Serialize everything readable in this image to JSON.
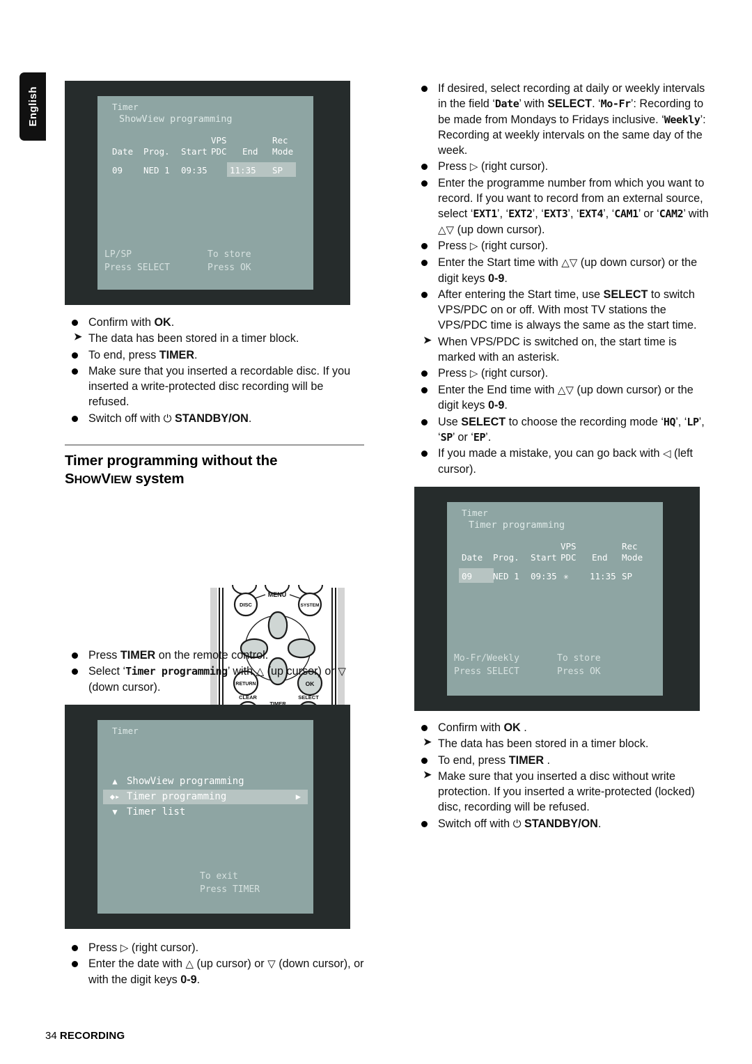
{
  "language_tab": {
    "label": "English"
  },
  "footer": {
    "page_number": "34",
    "section": "RECORDING"
  },
  "heading": {
    "line1": "Timer programming without the",
    "line2_cap": "S",
    "line2_small1": "HOW",
    "line2_cap2": "V",
    "line2_small2": "IEW",
    "line2_rest": " system"
  },
  "screen_showview": {
    "title": "Timer",
    "subtitle": "ShowView programming",
    "headers": {
      "date": "Date",
      "prog": "Prog.",
      "start": "Start",
      "vps": "VPS",
      "pdc": "PDC",
      "end": "End",
      "rec": "Rec",
      "mode": "Mode"
    },
    "row": {
      "date": "09",
      "prog": "NED 1",
      "start": "09:35",
      "vpspdc": "",
      "end": "11:35",
      "mode": "SP"
    },
    "footer_left_1": "LP/SP",
    "footer_left_2": "Press SELECT",
    "footer_right_1": "To store",
    "footer_right_2": "Press OK"
  },
  "screen_timer_menu": {
    "title": "Timer",
    "items": [
      {
        "marker": "▲",
        "label": "ShowView programming",
        "selected": false,
        "right": ""
      },
      {
        "marker": "◆▸",
        "label": "Timer programming",
        "selected": true,
        "right": "▶"
      },
      {
        "marker": "▼",
        "label": "Timer list",
        "selected": false,
        "right": ""
      }
    ],
    "footer_1": "To exit",
    "footer_2": "Press TIMER"
  },
  "screen_timer_programming": {
    "title": "Timer",
    "subtitle": "Timer programming",
    "headers": {
      "date": "Date",
      "prog": "Prog.",
      "start": "Start",
      "vps": "VPS",
      "pdc": "PDC",
      "end": "End",
      "rec": "Rec",
      "mode": "Mode"
    },
    "row": {
      "date": "09",
      "prog": "NED 1",
      "start": "09:35",
      "vpspdc": "✳",
      "end": "11:35",
      "mode": "SP"
    },
    "footer_left_1": "Mo-Fr/Weekly",
    "footer_left_2": "Press SELECT",
    "footer_right_1": "To store",
    "footer_right_2": "Press OK"
  },
  "remote": {
    "labels": {
      "menu": "MENU",
      "disc": "DISC",
      "system": "SYSTEM",
      "return": "RETURN",
      "ok": "OK",
      "clear": "CLEAR",
      "timer": "TIMER",
      "select": "SELECT"
    }
  },
  "left_column": {
    "list1": [
      {
        "type": "bullet",
        "html": "Confirm with <b>OK</b>."
      },
      {
        "type": "arrow",
        "html": "The data has been stored in a timer block."
      },
      {
        "type": "bullet",
        "html": "To end, press <b>TIMER</b>."
      },
      {
        "type": "bullet",
        "html": "Make sure that you inserted a recordable disc. If you inserted a write-protected disc recording will be refused."
      },
      {
        "type": "bullet",
        "html": "Switch off with <span class=\"cur\">⏻</span> <b>STANDBY/ON</b>."
      }
    ],
    "list2": [
      {
        "type": "bullet",
        "html": "Press <b>TIMER</b> on the remote control."
      },
      {
        "type": "bullet",
        "html": "Select ‘<span class=\"osd\">Timer programming</span>’ with <span class=\"cur\">△</span> (up cursor) or <span class=\"cur\">▽</span> (down cursor)."
      }
    ],
    "list3": [
      {
        "type": "bullet",
        "html": "Press <span class=\"cur\">▷</span> (right cursor)."
      },
      {
        "type": "bullet",
        "html": "Enter the date with <span class=\"cur\">△</span> (up cursor) or <span class=\"cur\">▽</span> (down cursor), or with the digit keys <b>0-9</b>."
      }
    ]
  },
  "right_column": {
    "list1": [
      {
        "type": "bullet",
        "html": "If desired, select recording at daily or weekly intervals in the field ‘<span class=\"osd\">Date</span>’ with <b>SELECT</b>. ‘<span class=\"osd\">Mo-Fr</span>’: Recording to be made from Mondays to Fridays inclusive. ‘<span class=\"osd\">Weekly</span>’: Recording at weekly intervals on the same day of the week."
      },
      {
        "type": "bullet",
        "html": "Press <span class=\"cur\">▷</span> (right cursor)."
      },
      {
        "type": "bullet",
        "html": "Enter the programme number from which you want to record. If you want to record from an external source, select ‘<span class=\"osd\">EXT1</span>’, ‘<span class=\"osd\">EXT2</span>’, ‘<span class=\"osd\">EXT3</span>’, ‘<span class=\"osd\">EXT4</span>’, ‘<span class=\"osd\">CAM1</span>’ or ‘<span class=\"osd\">CAM2</span>’ with <span class=\"cur\">△▽</span> (up down cursor)."
      },
      {
        "type": "bullet",
        "html": "Press <span class=\"cur\">▷</span> (right cursor)."
      },
      {
        "type": "bullet",
        "html": "Enter the Start time with <span class=\"cur\">△▽</span> (up down cursor) or the digit keys <b>0-9</b>."
      },
      {
        "type": "bullet",
        "html": "After entering the Start time, use <b>SELECT</b> to switch VPS/PDC on or off. With most TV stations the VPS/PDC time is always the same as the start time."
      },
      {
        "type": "arrow",
        "html": "When VPS/PDC is switched on, the start time is marked with an asterisk."
      },
      {
        "type": "bullet",
        "html": "Press <span class=\"cur\">▷</span> (right cursor)."
      },
      {
        "type": "bullet",
        "html": "Enter the End time with <span class=\"cur\">△▽</span> (up down cursor) or the digit keys <b>0-9</b>."
      },
      {
        "type": "bullet",
        "html": "Use <b>SELECT</b> to choose the recording mode ‘<span class=\"osd\">HQ</span>’, ‘<span class=\"osd\">LP</span>’, ‘<span class=\"osd\">SP</span>’ or ‘<span class=\"osd\">EP</span>’."
      },
      {
        "type": "bullet",
        "html": "If you made a mistake, you can go back with <span class=\"cur\">◁</span> (left cursor)."
      }
    ],
    "list2": [
      {
        "type": "bullet",
        "html": "Confirm with <b>OK</b> ."
      },
      {
        "type": "arrow",
        "html": "The data has been stored in a timer block."
      },
      {
        "type": "bullet",
        "html": "To end, press <b>TIMER</b> ."
      },
      {
        "type": "arrow",
        "html": "Make sure that you inserted a disc without write protection. If you inserted a write-protected (locked) disc, recording will be refused."
      },
      {
        "type": "bullet",
        "html": "Switch off with <span class=\"cur\">⏻</span> <b>STANDBY/ON</b>."
      }
    ]
  }
}
